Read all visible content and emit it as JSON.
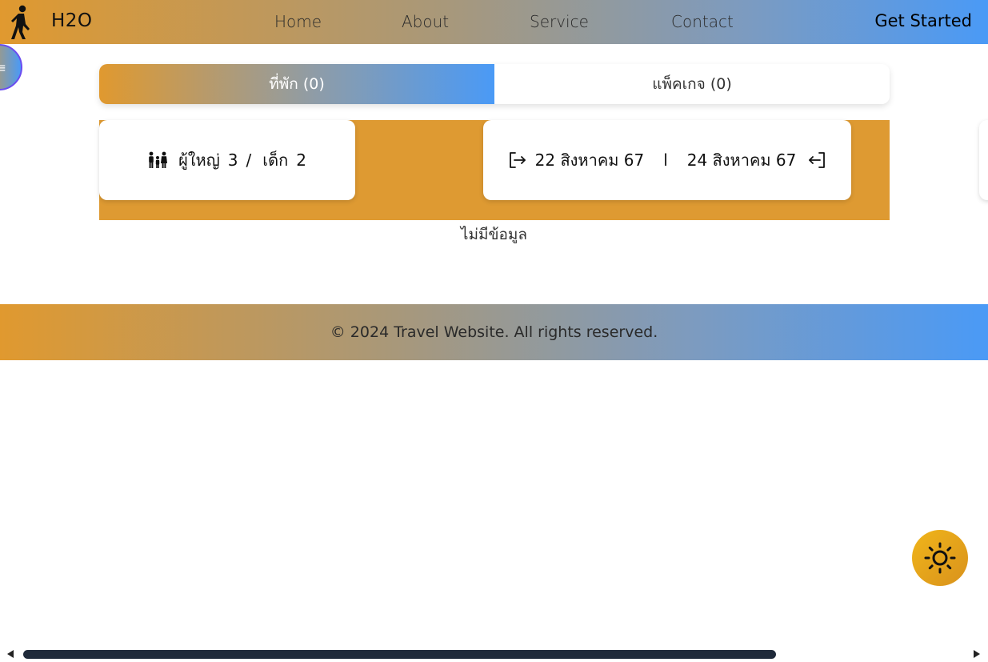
{
  "navbar": {
    "brand": "H2O",
    "links": [
      "Home",
      "About",
      "Service",
      "Contact"
    ],
    "cta": "Get Started"
  },
  "side_toggle": {
    "icon": "≡"
  },
  "tabs": [
    {
      "label": "ที่พัก (0)",
      "active": true
    },
    {
      "label": "แพ็คเกจ (0)",
      "active": false
    }
  ],
  "search": {
    "adults_label": "ผู้ใหญ่",
    "adults_count": "3",
    "separator": "/",
    "children_label": "เด็ก",
    "children_count": "2",
    "checkin_date": "22 สิงหาคม 67",
    "date_separator": "l",
    "checkout_date": "24 สิงหาคม 67"
  },
  "results": {
    "empty_message": "ไม่มีข้อมูล"
  },
  "footer": {
    "copyright": "© 2024 Travel Website. All rights reserved."
  },
  "colors": {
    "accent_orange": "#de9a32",
    "accent_blue": "#4a9af6",
    "theme_toggle": "#f0b51a"
  },
  "icons": [
    "walking-person-icon",
    "menu-icon",
    "family-icon",
    "checkin-icon",
    "checkout-icon",
    "sun-icon"
  ]
}
